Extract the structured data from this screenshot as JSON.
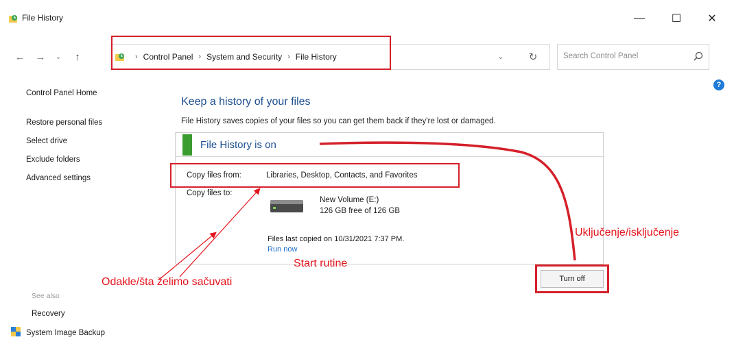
{
  "window": {
    "title": "File History",
    "minimize_glyph": "—",
    "maximize_glyph": "☐",
    "close_glyph": "✕"
  },
  "nav": {
    "back_glyph": "←",
    "forward_glyph": "→",
    "recent_glyph": "⌄",
    "up_glyph": "↑"
  },
  "address": {
    "crumbs": [
      "Control Panel",
      "System and Security",
      "File History"
    ],
    "separator": "›",
    "dropdown_glyph": "⌄",
    "refresh_glyph": "↻"
  },
  "search": {
    "placeholder": "Search Control Panel"
  },
  "sidebar": {
    "home": "Control Panel Home",
    "items": [
      "Restore personal files",
      "Select drive",
      "Exclude folders",
      "Advanced settings"
    ],
    "see_also_label": "See also",
    "see_also_items": [
      "Recovery",
      "System Image Backup"
    ]
  },
  "main": {
    "heading": "Keep a history of your files",
    "description": "File History saves copies of your files so you can get them back if they're lost or damaged.",
    "status": "File History is on",
    "copy_from_label": "Copy files from:",
    "copy_from_value": "Libraries, Desktop, Contacts, and Favorites",
    "copy_to_label": "Copy files to:",
    "drive_name": "New Volume (E:)",
    "drive_free": "126 GB free of 126 GB",
    "last_copied": "Files last copied on 10/31/2021 7:37 PM.",
    "run_now": "Run now",
    "turn_off": "Turn off"
  },
  "help": {
    "glyph": "?"
  },
  "annotations": {
    "on_off": "Uključenje/isključenje",
    "start": "Start rutine",
    "source": "Odakle/šta želimo sačuvati"
  },
  "colors": {
    "highlight_red": "#d4202a",
    "heading_blue": "#1e4f91",
    "status_green": "#3a9b2e",
    "link_blue": "#1e6fc9"
  },
  "icons": [
    "file-history-icon",
    "search-icon",
    "help-icon",
    "drive-icon",
    "shield-icon"
  ]
}
